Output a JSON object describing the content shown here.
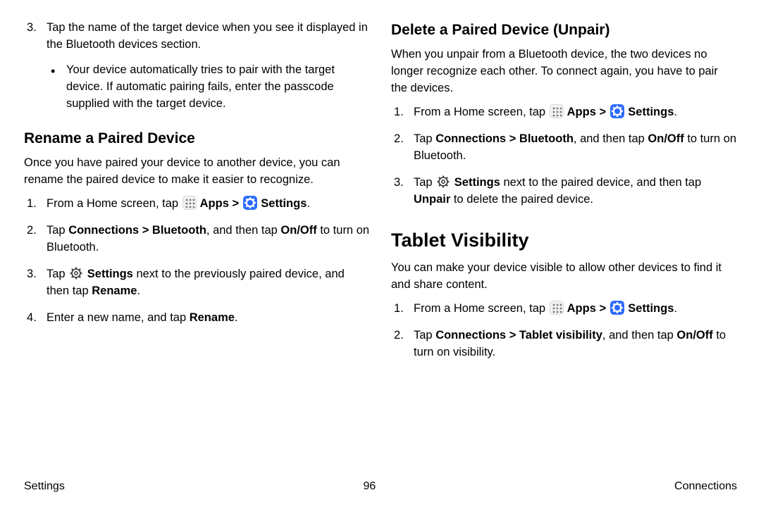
{
  "left": {
    "step3": "Tap the name of the target device when you see it displayed in the Bluetooth devices section.",
    "step3_bullet": "Your device automatically tries to pair with the target device. If automatic pairing fails, enter the passcode supplied with the target device.",
    "rename_heading": "Rename a Paired Device",
    "rename_intro": "Once you have paired your device to another device, you can rename the paired device to make it easier to recognize.",
    "r1_a": "From a Home screen, tap ",
    "apps_label": " Apps",
    "caret": " > ",
    "settings_label": " Settings",
    "r2_a": "Tap ",
    "connections": "Connections",
    "sep": " > ",
    "bluetooth": "Bluetooth",
    "r2_b": ", and then tap ",
    "onoff": "On/Off",
    "r2_c": " to turn on Bluetooth.",
    "r3_a": "Tap ",
    "r3_settings": " Settings",
    "r3_b": " next to the previously paired device, and then tap ",
    "rename": "Rename",
    "r4_a": "Enter a new name, and tap ",
    "period": "."
  },
  "right": {
    "delete_heading": "Delete a Paired Device (Unpair)",
    "delete_intro": "When you unpair from a Bluetooth device, the two devices no longer recognize each other. To connect again, you have to pair the devices.",
    "d1_a": "From a Home screen, tap ",
    "apps_label": " Apps",
    "caret": " > ",
    "settings_label": " Settings",
    "d2_a": "Tap ",
    "connections": "Connections",
    "sep": " > ",
    "bluetooth": "Bluetooth",
    "d2_b": ", and then tap ",
    "onoff": "On/Off",
    "d2_c": " to turn on Bluetooth.",
    "d3_a": "Tap ",
    "d3_settings": " Settings",
    "d3_b": " next to the paired device, and then tap ",
    "unpair": "Unpair",
    "d3_c": " to delete the paired device.",
    "tablet_heading": "Tablet Visibility",
    "tablet_intro": "You can make your device visible to allow other devices to find it and share content.",
    "t1_a": "From a Home screen, tap ",
    "t2_a": "Tap ",
    "t2_conn": "Connections",
    "t2_sep": " > ",
    "t2_vis": "Tablet visibility",
    "t2_b": ", and then tap ",
    "t2_onoff": "On/Off",
    "t2_c": " to turn on visibility.",
    "period": "."
  },
  "footer": {
    "left": "Settings",
    "center": "96",
    "right": "Connections"
  }
}
